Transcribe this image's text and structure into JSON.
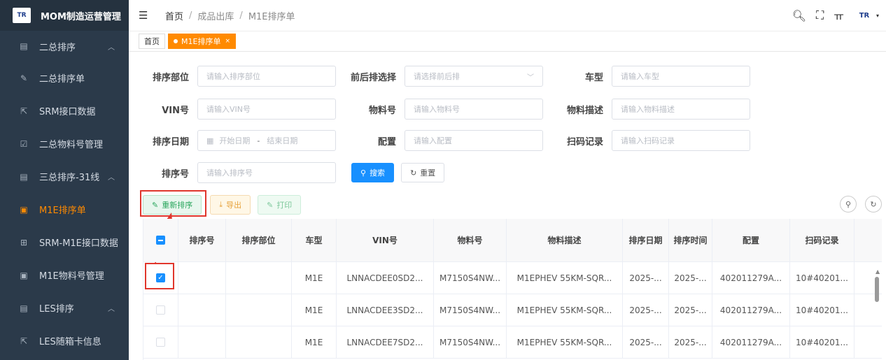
{
  "app": {
    "logo_text": "TR",
    "title": "MOM制造运营管理"
  },
  "sidebar": {
    "items": [
      {
        "label": "二总排序",
        "icon": "board-icon",
        "arrow": "^"
      },
      {
        "label": "二总排序单",
        "icon": "edit-icon"
      },
      {
        "label": "SRM接口数据",
        "icon": "plug-icon"
      },
      {
        "label": "二总物料号管理",
        "icon": "checkbox-icon"
      },
      {
        "label": "三总排序-31线",
        "icon": "board-icon",
        "arrow": "^"
      },
      {
        "label": "M1E排序单",
        "icon": "list-icon",
        "active": true
      },
      {
        "label": "SRM-M1E接口数据",
        "icon": "grid-icon"
      },
      {
        "label": "M1E物料号管理",
        "icon": "list-icon"
      },
      {
        "label": "LES排序",
        "icon": "board-icon",
        "arrow": "^"
      },
      {
        "label": "LES随箱卡信息",
        "icon": "plug-icon"
      }
    ]
  },
  "header": {
    "breadcrumb": [
      "首页",
      "成品出库",
      "M1E排序单"
    ],
    "separator": "/",
    "user_logo": "TR"
  },
  "tags": {
    "home": "首页",
    "current": "M1E排序单",
    "close": "×"
  },
  "form": {
    "paixu_bumen": {
      "label": "排序部位",
      "placeholder": "请输入排序部位"
    },
    "qianhoupai": {
      "label": "前后排选择",
      "placeholder": "请选择前后排"
    },
    "chexing": {
      "label": "车型",
      "placeholder": "请输入车型"
    },
    "vin": {
      "label": "VIN号",
      "placeholder": "请输入VIN号"
    },
    "wuliaohao": {
      "label": "物料号",
      "placeholder": "请输入物料号"
    },
    "wuliaomiaoshu": {
      "label": "物料描述",
      "placeholder": "请输入物料描述"
    },
    "paixu_riqi": {
      "label": "排序日期",
      "start": "开始日期",
      "sep": "-",
      "end": "结束日期"
    },
    "peizhi": {
      "label": "配置",
      "placeholder": "请输入配置"
    },
    "saoma": {
      "label": "扫码记录",
      "placeholder": "请输入扫码记录"
    },
    "paixuhao": {
      "label": "排序号",
      "placeholder": "请输入排序号"
    },
    "search_button": "搜索",
    "reset_button": "重置"
  },
  "toolbar": {
    "resort": "重新排序",
    "export": "导出",
    "print": "打印"
  },
  "table": {
    "columns": [
      "排序号",
      "排序部位",
      "车型",
      "VIN号",
      "物料号",
      "物料描述",
      "排序日期",
      "排序时间",
      "配置",
      "扫码记录"
    ],
    "rows": [
      {
        "checked": true,
        "seq": "",
        "part": "",
        "model": "M1E",
        "vin": "LNNACDEE0SD2...",
        "material": "M7150S4NW...",
        "desc": "M1EPHEV 55KM-SQR...",
        "date": "2025-...",
        "time": "2025-...",
        "config": "402011279A...",
        "scan": "10#40201..."
      },
      {
        "checked": false,
        "seq": "",
        "part": "",
        "model": "M1E",
        "vin": "LNNACDEE3SD2...",
        "material": "M7150S4NW...",
        "desc": "M1EPHEV 55KM-SQR...",
        "date": "2025-...",
        "time": "2025-...",
        "config": "402011279A...",
        "scan": "10#40201..."
      },
      {
        "checked": false,
        "seq": "",
        "part": "",
        "model": "M1E",
        "vin": "LNNACDEE7SD2...",
        "material": "M7150S4NW...",
        "desc": "M1EPHEV 55KM-SQR...",
        "date": "2025-...",
        "time": "2025-...",
        "config": "402011279A...",
        "scan": "10#40201..."
      }
    ]
  },
  "colors": {
    "accent": "#ff8a00",
    "primary": "#1890ff",
    "sidebar": "#2b3a4a",
    "annotation": "#e0362c"
  }
}
